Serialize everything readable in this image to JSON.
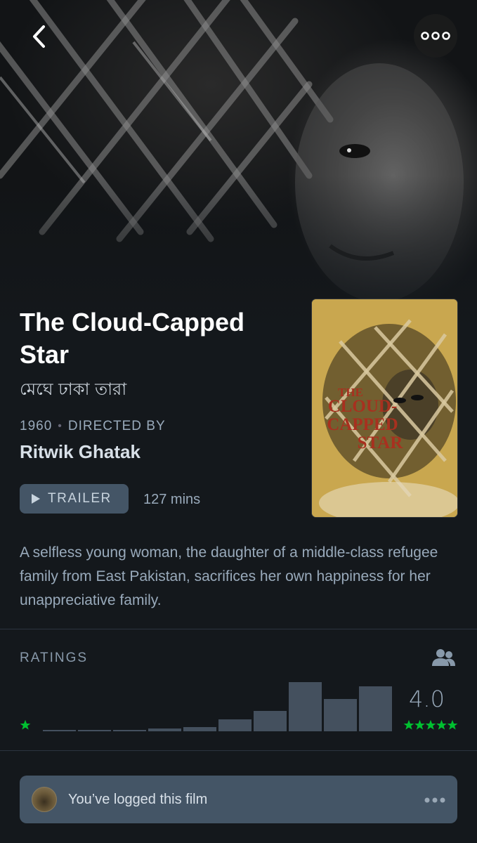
{
  "film": {
    "title": "The Cloud-Capped Star",
    "original_title": "মেঘে ঢাকা তারা",
    "year": "1960",
    "directed_by_label": "DIRECTED BY",
    "director": "Ritwik Ghatak",
    "trailer_label": "TRAILER",
    "runtime": "127 mins",
    "synopsis": "A selfless young woman, the daughter of a middle-class refugee family from East Pakistan, sacrifices her own happiness for her unappreciative family."
  },
  "poster": {
    "title_lines": [
      "THE",
      "CLOUD-",
      "CAPPED",
      "STAR"
    ],
    "background_color": "#c9a74f",
    "title_color": "#a8301f"
  },
  "ratings": {
    "label": "RATINGS",
    "average": "4.0",
    "distribution_relative": [
      0.02,
      0.02,
      0.02,
      0.05,
      0.09,
      0.24,
      0.42,
      1.0,
      0.65,
      0.91
    ],
    "low_star_color": "#00c030",
    "high_stars_color": "#00c030"
  },
  "log_status": {
    "text": "You’ve logged this film"
  },
  "icons": {
    "back": "chevron-left-icon",
    "more": "more-dots-icon",
    "play": "play-icon",
    "members": "members-icon",
    "star": "star-icon"
  }
}
